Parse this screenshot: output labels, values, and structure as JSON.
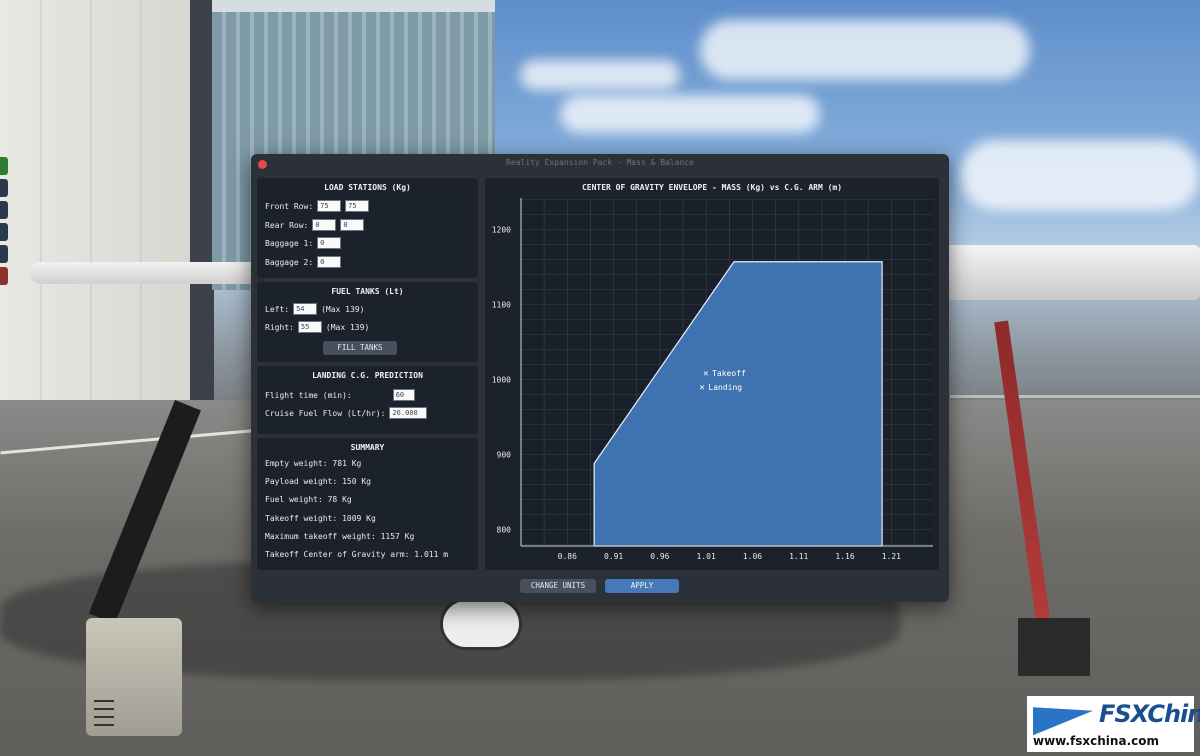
{
  "window": {
    "title": "Reality Expansion Pack - Mass & Balance"
  },
  "load_stations": {
    "title": "LOAD STATIONS (Kg)",
    "front_row": {
      "label": "Front Row:",
      "values": [
        "75",
        "75"
      ]
    },
    "rear_row": {
      "label": "Rear Row:",
      "values": [
        "0",
        "0"
      ]
    },
    "baggage1": {
      "label": "Baggage 1:",
      "value": "0"
    },
    "baggage2": {
      "label": "Baggage 2:",
      "value": "0"
    }
  },
  "fuel_tanks": {
    "title": "FUEL TANKS (Lt)",
    "left": {
      "label": "Left:",
      "value": "54",
      "max": "(Max 139)"
    },
    "right": {
      "label": "Right:",
      "value": "55",
      "max": "(Max 139)"
    },
    "fill_button": "FILL TANKS"
  },
  "landing_prediction": {
    "title": "LANDING C.G. PREDICTION",
    "flight_time": {
      "label": "Flight time (min):",
      "value": "60"
    },
    "cruise_fuel_flow": {
      "label": "Cruise Fuel Flow (Lt/hr):",
      "value": "26.000"
    }
  },
  "summary": {
    "title": "SUMMARY",
    "lines": [
      "Empty weight: 781 Kg",
      "Payload weight: 150 Kg",
      "Fuel weight: 78 Kg",
      "Takeoff weight: 1009 Kg",
      "Maximum takeoff weight: 1157 Kg",
      "Takeoff Center of Gravity arm: 1.011 m"
    ]
  },
  "buttons": {
    "change_units": "CHANGE UNITS",
    "apply": "APPLY"
  },
  "colors": {
    "envelope_fill": "#3e72b0",
    "envelope_stroke": "#e8eef6",
    "panel_bg": "#1c222c",
    "window_bg": "#2c3139",
    "apply_button": "#4779b8",
    "close_button": "#e34b45"
  },
  "chart_data": {
    "type": "area",
    "title": "CENTER OF GRAVITY ENVELOPE - MASS (Kg) vs C.G. ARM (m)",
    "xlabel": "",
    "ylabel": "",
    "xlim": [
      0.81,
      1.255
    ],
    "ylim": [
      778,
      1242
    ],
    "x_ticks": [
      0.86,
      0.91,
      0.96,
      1.01,
      1.06,
      1.11,
      1.16,
      1.21
    ],
    "y_ticks": [
      800,
      900,
      1000,
      1100,
      1200
    ],
    "grid": true,
    "envelope": [
      {
        "x": 0.889,
        "y": 778
      },
      {
        "x": 0.889,
        "y": 888
      },
      {
        "x": 1.04,
        "y": 1157
      },
      {
        "x": 1.2,
        "y": 1157
      },
      {
        "x": 1.2,
        "y": 778
      }
    ],
    "markers": [
      {
        "label": "Takeoff",
        "x": 1.011,
        "y": 1009
      },
      {
        "label": "Landing",
        "x": 1.007,
        "y": 990
      }
    ]
  },
  "watermark": {
    "logo": "FSXChina",
    "url": "www.fsxchina.com"
  }
}
